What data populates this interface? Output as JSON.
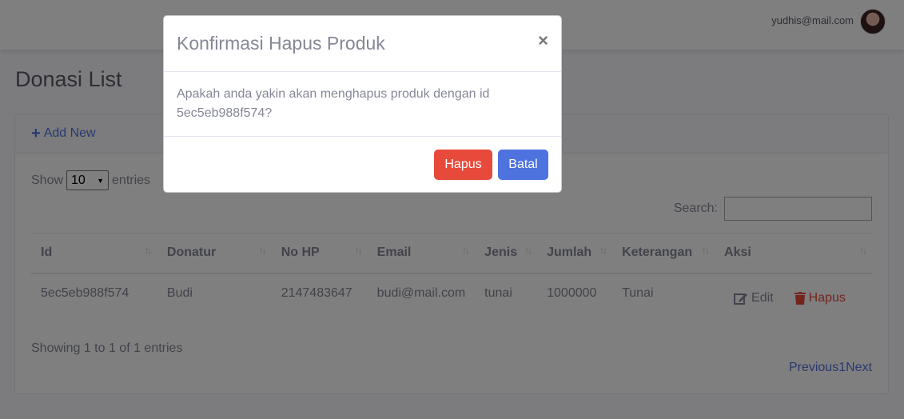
{
  "topbar": {
    "user_email": "yudhis@mail.com"
  },
  "page": {
    "title": "Donasi List"
  },
  "card": {
    "add_new_label": "Add New",
    "show_label": "Show",
    "entries_value": "10",
    "entries_label": "entries",
    "search_label": "Search:",
    "columns": [
      "Id",
      "Donatur",
      "No HP",
      "Email",
      "Jenis",
      "Jumlah",
      "Keterangan",
      "Aksi"
    ],
    "rows": [
      {
        "id": "5ec5eb988f574",
        "donatur": "Budi",
        "no_hp": "2147483647",
        "email": "budi@mail.com",
        "jenis": "tunai",
        "jumlah": "1000000",
        "keterangan": "Tunai",
        "edit_label": "Edit",
        "hapus_label": "Hapus"
      }
    ],
    "info": "Showing 1 to 1 of 1 entries",
    "pagination": {
      "previous": "Previous",
      "page": "1",
      "next": "Next"
    }
  },
  "modal": {
    "title": "Konfirmasi Hapus Produk",
    "close": "×",
    "body_line1": "Apakah anda yakin akan menghapus produk dengan id",
    "body_line2": "5ec5eb988f574?",
    "hapus_label": "Hapus",
    "batal_label": "Batal"
  },
  "colors": {
    "primary": "#4e73df",
    "danger": "#e74a3b",
    "text": "#858796"
  }
}
